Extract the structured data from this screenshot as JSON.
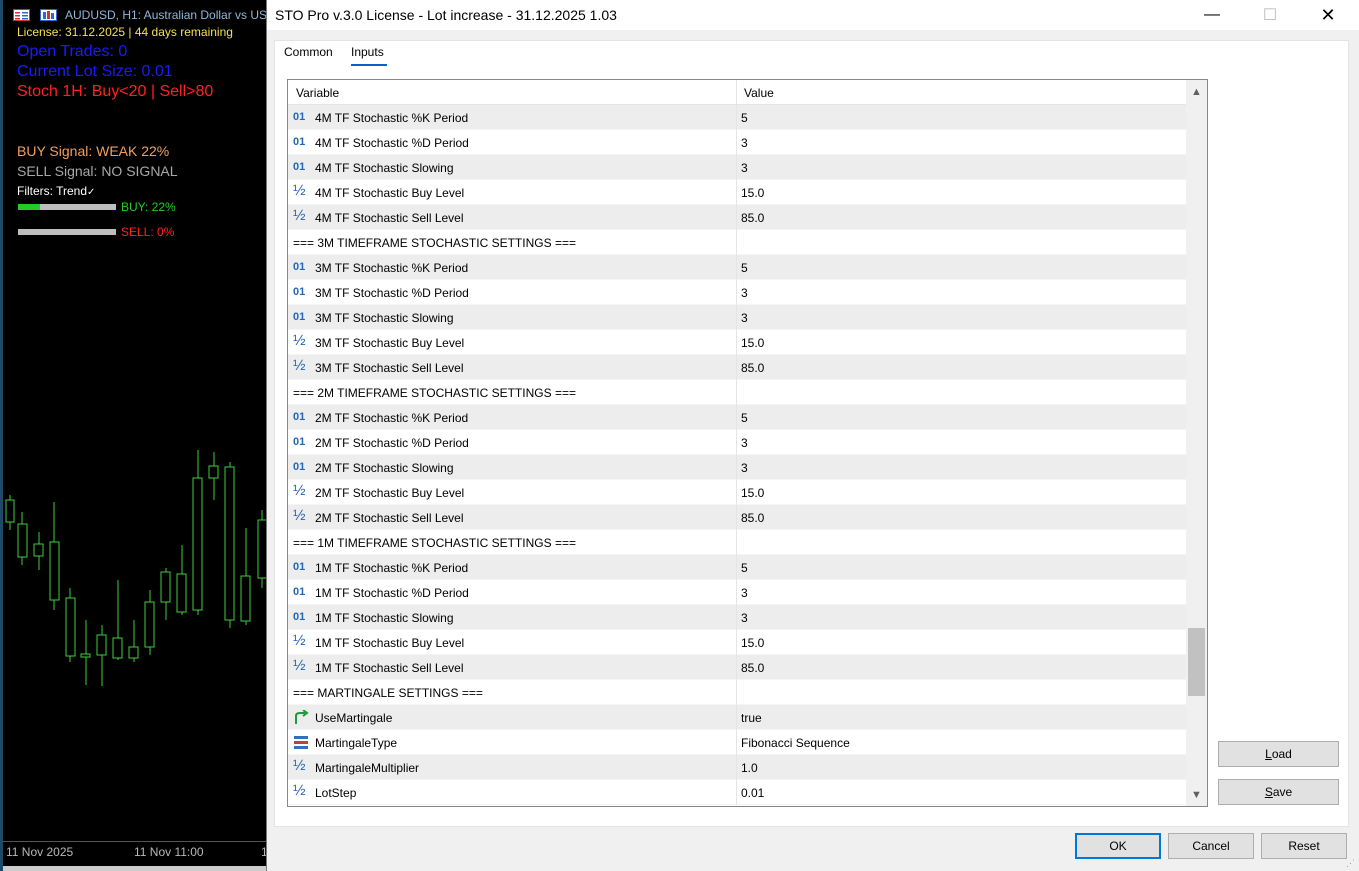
{
  "chart": {
    "title": "AUDUSD, H1:  Australian Dollar vs US",
    "license_line": "License: 31.12.2025 | 44 days remaining",
    "open_trades": "Open Trades: 0",
    "lot_size": "Current Lot Size: 0.01",
    "stoch": "Stoch 1H: Buy<20 | Sell>80",
    "buy_signal": "BUY Signal: WEAK 22%",
    "sell_signal": "SELL Signal: NO SIGNAL",
    "filters": "Filters: Trend",
    "filters_check": "✓",
    "buy_bar_label": "BUY: 22%",
    "buy_bar_fraction": 0.22,
    "sell_bar_label": "SELL: 0%",
    "sell_bar_fraction": 0,
    "x_ticks": [
      "11 Nov 2025",
      "11 Nov 11:00",
      "1"
    ],
    "colors": {
      "license": "#f5e050",
      "blue": "#1a1aff",
      "red": "#ff2020",
      "orange": "#f0a060",
      "gray": "#a8a8a8",
      "green": "#22cc22",
      "candle": "#3dd13d"
    }
  },
  "dialog": {
    "title": "STO Pro v.3.0 License - Lot increase - 31.12.2025 1.03",
    "minimize": "—",
    "maximize": "☐",
    "close": "✕",
    "tabs": [
      {
        "label": "Common",
        "active": false
      },
      {
        "label": "Inputs",
        "active": true
      }
    ],
    "columns": {
      "variable": "Variable",
      "value": "Value"
    },
    "rows": [
      {
        "icon": "int",
        "name": "4M TF Stochastic %K Period",
        "value": "5"
      },
      {
        "icon": "int",
        "name": "4M TF Stochastic %D Period",
        "value": "3"
      },
      {
        "icon": "int",
        "name": "4M TF Stochastic Slowing",
        "value": "3"
      },
      {
        "icon": "double",
        "name": "4M TF Stochastic Buy Level",
        "value": "15.0"
      },
      {
        "icon": "double",
        "name": "4M TF Stochastic Sell Level",
        "value": "85.0"
      },
      {
        "icon": "none",
        "name": "=== 3M TIMEFRAME STOCHASTIC SETTINGS ===",
        "value": ""
      },
      {
        "icon": "int",
        "name": "3M TF Stochastic %K Period",
        "value": "5"
      },
      {
        "icon": "int",
        "name": "3M TF Stochastic %D Period",
        "value": "3"
      },
      {
        "icon": "int",
        "name": "3M TF Stochastic Slowing",
        "value": "3"
      },
      {
        "icon": "double",
        "name": "3M TF Stochastic Buy Level",
        "value": "15.0"
      },
      {
        "icon": "double",
        "name": "3M TF Stochastic Sell Level",
        "value": "85.0"
      },
      {
        "icon": "none",
        "name": "=== 2M TIMEFRAME STOCHASTIC SETTINGS ===",
        "value": ""
      },
      {
        "icon": "int",
        "name": "2M TF Stochastic %K Period",
        "value": "5"
      },
      {
        "icon": "int",
        "name": "2M TF Stochastic %D Period",
        "value": "3"
      },
      {
        "icon": "int",
        "name": "2M TF Stochastic Slowing",
        "value": "3"
      },
      {
        "icon": "double",
        "name": "2M TF Stochastic Buy Level",
        "value": "15.0"
      },
      {
        "icon": "double",
        "name": "2M TF Stochastic Sell Level",
        "value": "85.0"
      },
      {
        "icon": "none",
        "name": "=== 1M TIMEFRAME STOCHASTIC SETTINGS ===",
        "value": ""
      },
      {
        "icon": "int",
        "name": "1M TF Stochastic %K Period",
        "value": "5"
      },
      {
        "icon": "int",
        "name": "1M TF Stochastic %D Period",
        "value": "3"
      },
      {
        "icon": "int",
        "name": "1M TF Stochastic Slowing",
        "value": "3"
      },
      {
        "icon": "double",
        "name": "1M TF Stochastic Buy Level",
        "value": "15.0"
      },
      {
        "icon": "double",
        "name": "1M TF Stochastic Sell Level",
        "value": "85.0"
      },
      {
        "icon": "none",
        "name": "=== MARTINGALE SETTINGS ===",
        "value": ""
      },
      {
        "icon": "bool",
        "name": "UseMartingale",
        "value": "true"
      },
      {
        "icon": "enum",
        "name": "MartingaleType",
        "value": "Fibonacci Sequence"
      },
      {
        "icon": "double",
        "name": "MartingaleMultiplier",
        "value": "1.0"
      },
      {
        "icon": "double",
        "name": "LotStep",
        "value": "0.01"
      }
    ],
    "icon_glyphs": {
      "int": "01",
      "double": "½"
    },
    "buttons": {
      "load_first": "L",
      "load_rest": "oad",
      "save_first": "S",
      "save_rest": "ave",
      "ok": "OK",
      "cancel": "Cancel",
      "reset": "Reset"
    }
  }
}
